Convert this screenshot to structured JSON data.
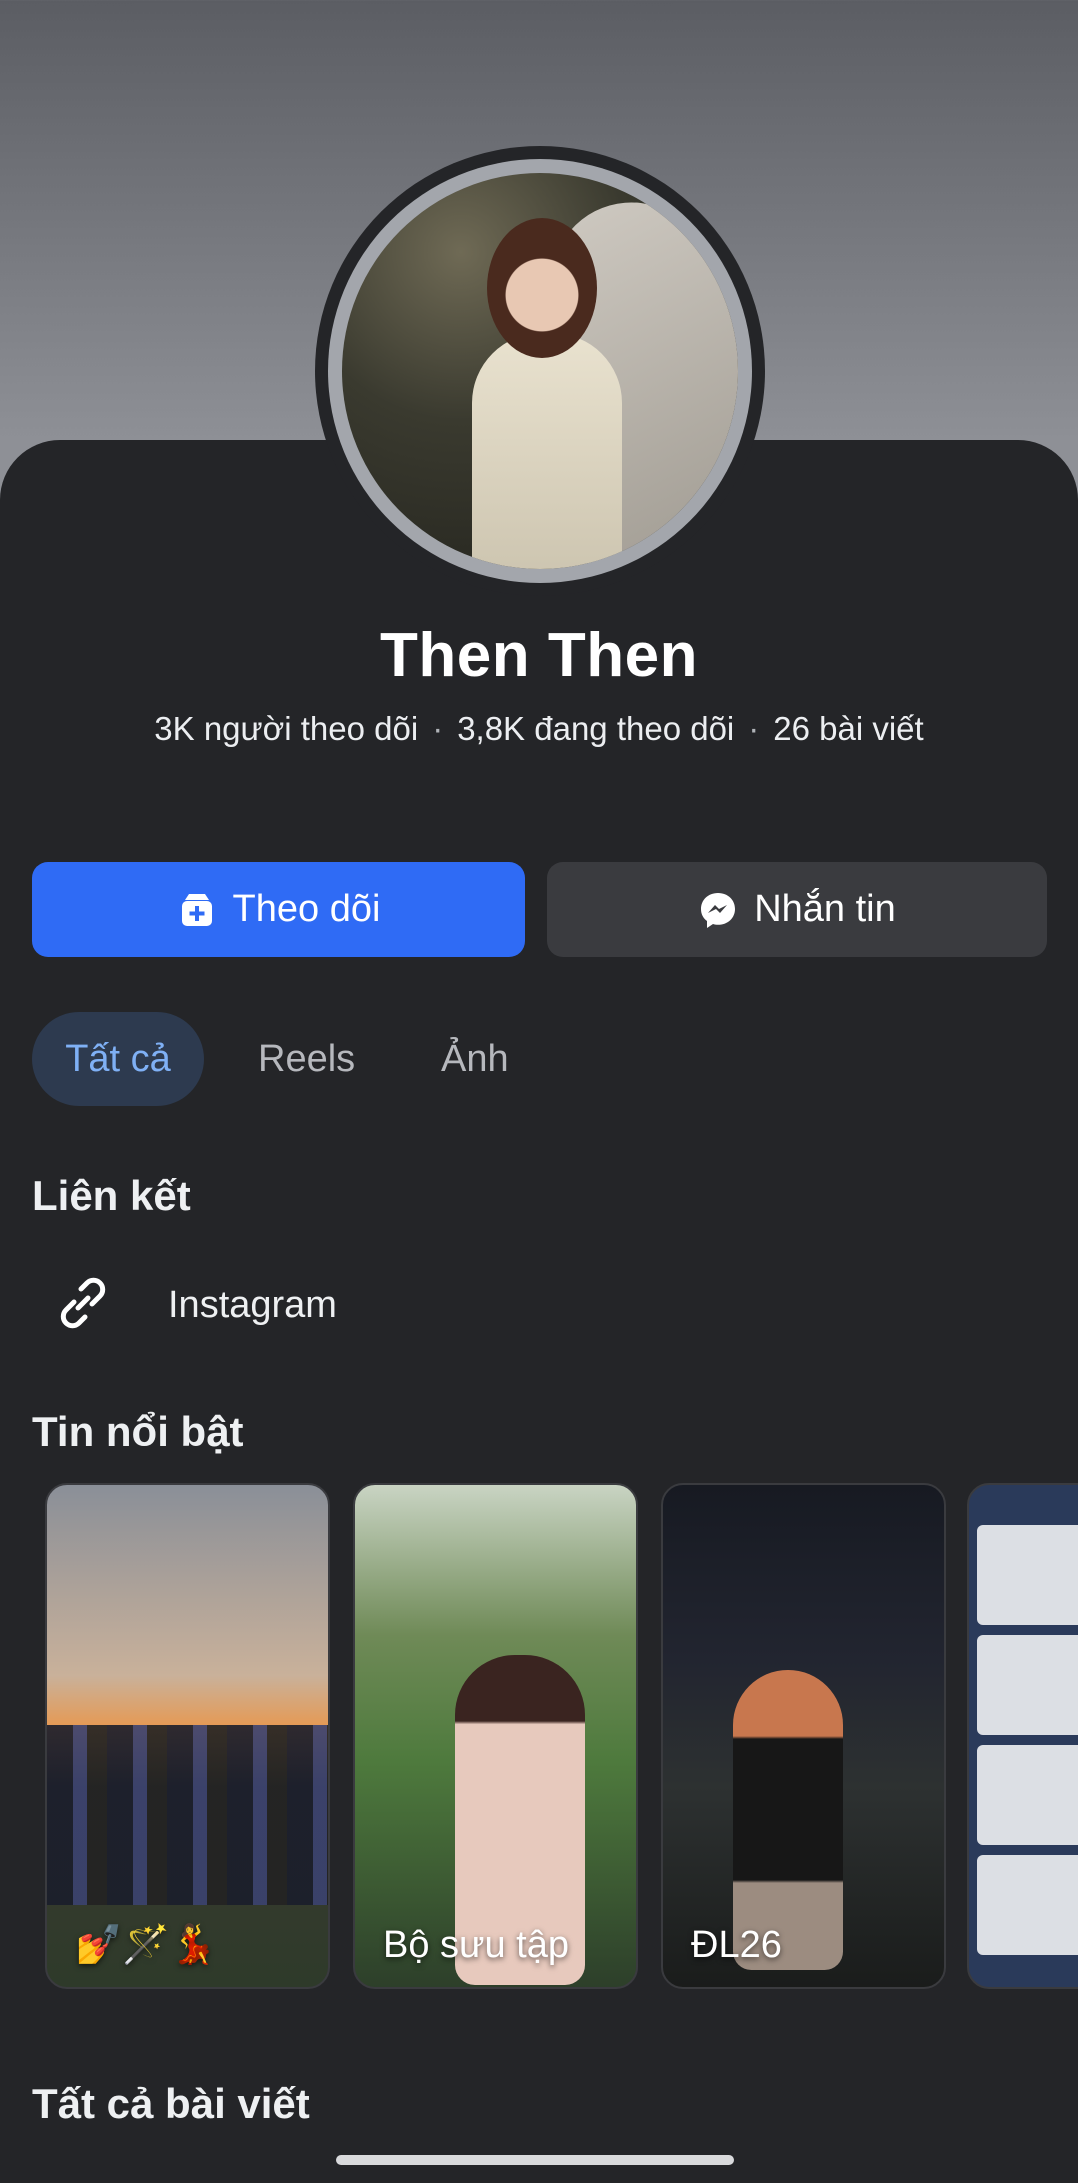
{
  "profile": {
    "name": "Then Then",
    "followers": "3K người theo dõi",
    "following": "3,8K đang theo dõi",
    "posts": "26 bài viết",
    "separator": "·"
  },
  "actions": {
    "follow_label": "Theo dõi",
    "message_label": "Nhắn tin",
    "follow_color": "#2f6bf5"
  },
  "tabs": [
    {
      "label": "Tất cả",
      "selected": true
    },
    {
      "label": "Reels",
      "selected": false
    },
    {
      "label": "Ảnh",
      "selected": false
    }
  ],
  "links": {
    "title": "Liên kết",
    "items": [
      {
        "label": "Instagram",
        "icon": "link-icon"
      }
    ]
  },
  "highlights": {
    "title": "Tin nổi bật",
    "items": [
      {
        "label": "💅🪄💃"
      },
      {
        "label": "Bộ sưu tập"
      },
      {
        "label": "ĐL26"
      },
      {
        "label": ""
      }
    ]
  },
  "all_posts": {
    "title": "Tất cả bài viết"
  }
}
